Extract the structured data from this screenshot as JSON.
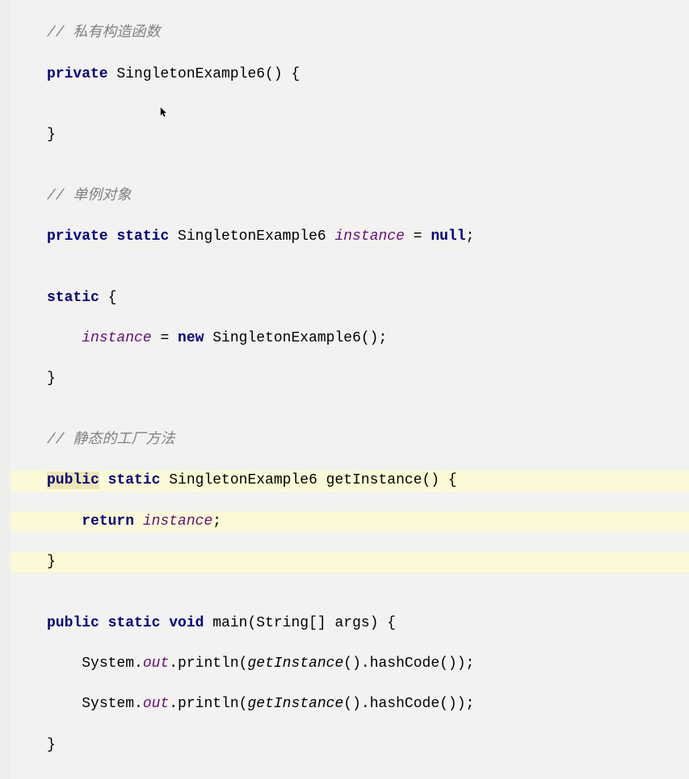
{
  "code": {
    "line1_comment": "// 私有构造函数",
    "line2_private": "private",
    "line2_rest": " SingletonExample6() {",
    "line3_empty": "",
    "line4_brace": "}",
    "line5_empty": "",
    "line6_comment": "// 单例对象",
    "line7_private": "private",
    "line7_static": "static",
    "line7_type": " SingletonExample6 ",
    "line7_field": "instance",
    "line7_eq": " = ",
    "line7_null": "null",
    "line7_semi": ";",
    "line8_empty": "",
    "line9_static": "static",
    "line9_brace": " {",
    "line10_field": "instance",
    "line10_eq": " = ",
    "line10_new": "new",
    "line10_rest": " SingletonExample6();",
    "line11_brace": "}",
    "line12_empty": "",
    "line13_comment": "// 静态的工厂方法",
    "line14_public": "public",
    "line14_static": "static",
    "line14_rest": " SingletonExample6 getInstance() {",
    "line15_return": "return",
    "line15_sp": " ",
    "line15_field": "instance",
    "line15_semi": ";",
    "line16_brace": "}",
    "line17_empty": "",
    "line18_public": "public",
    "line18_static": "static",
    "line18_void": "void",
    "line18_rest": " main(String[] args) {",
    "line19_sys": "System.",
    "line19_out": "out",
    "line19_print": ".println(",
    "line19_getinst": "getInstance",
    "line19_rest": "().hashCode());",
    "line20_sys": "System.",
    "line20_out": "out",
    "line20_print": ".println(",
    "line20_getinst": "getInstance",
    "line20_rest": "().hashCode());",
    "line21_brace": "}"
  }
}
